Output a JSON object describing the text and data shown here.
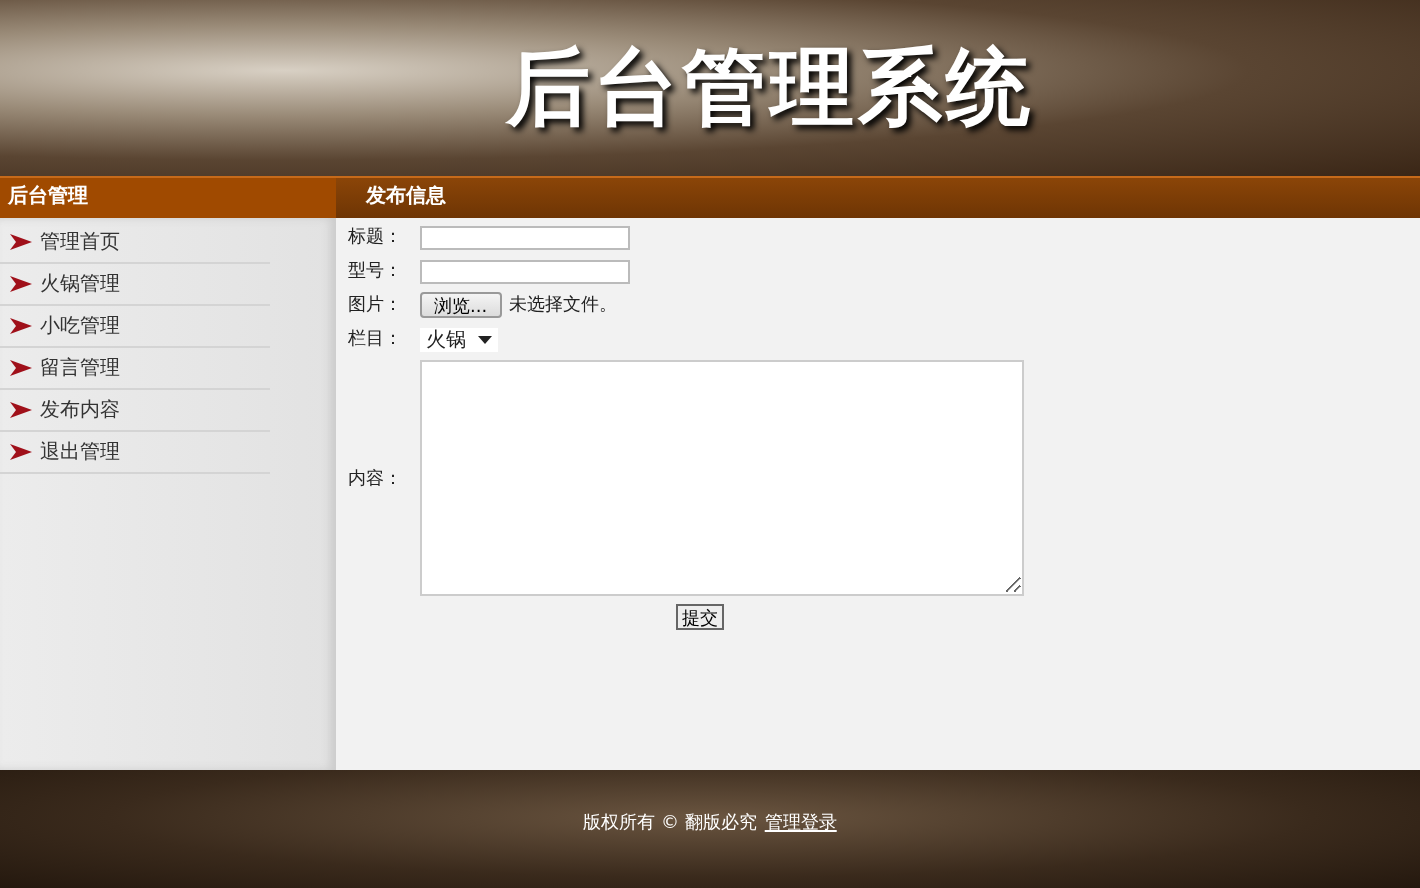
{
  "header": {
    "title": "后台管理系统"
  },
  "sidebar": {
    "title": "后台管理",
    "items": [
      {
        "label": "管理首页"
      },
      {
        "label": "火锅管理"
      },
      {
        "label": "小吃管理"
      },
      {
        "label": "留言管理"
      },
      {
        "label": "发布内容"
      },
      {
        "label": "退出管理"
      }
    ]
  },
  "content": {
    "title": "发布信息",
    "fields": [
      {
        "kind": "text",
        "label": "标题："
      },
      {
        "kind": "text",
        "label": "型号："
      },
      {
        "kind": "file",
        "label": "图片：",
        "button": "浏览...",
        "status": "未选择文件。"
      },
      {
        "kind": "select",
        "label": "栏目：",
        "value": "火锅"
      },
      {
        "kind": "textarea",
        "label": "内容："
      }
    ],
    "submit": "提交"
  },
  "footer": {
    "text": "版权所有 © 翻版必究",
    "link": "管理登录"
  }
}
